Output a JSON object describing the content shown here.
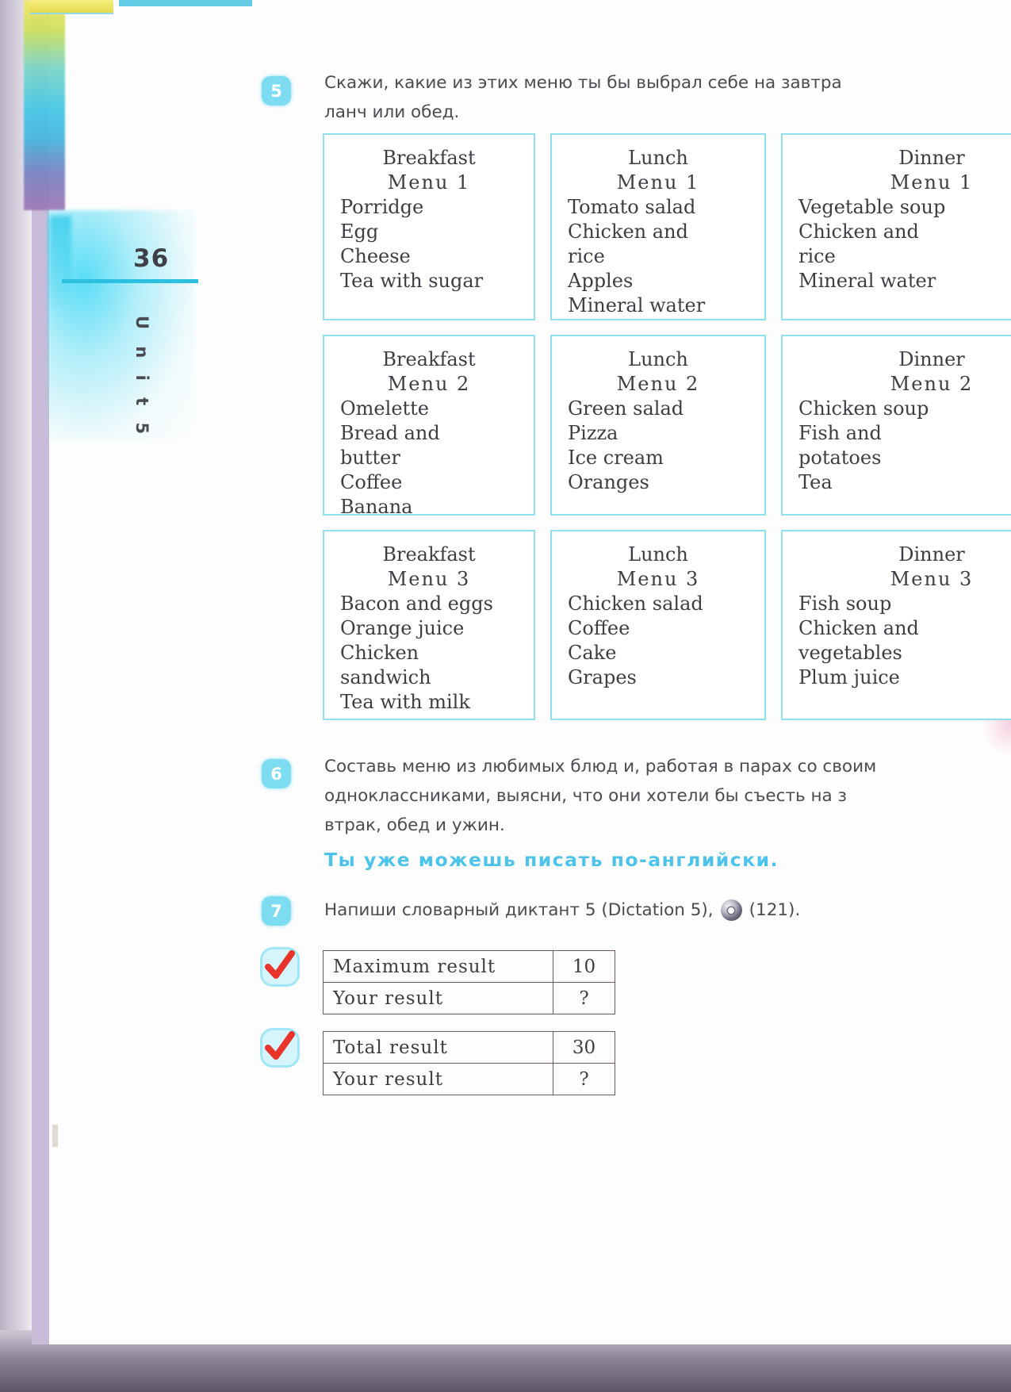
{
  "page": {
    "number": "36",
    "unit_label": "U n i t",
    "unit_number": "5"
  },
  "exercise5": {
    "badge": "5",
    "text": "Скажи, какие из этих меню ты бы выбрал себе на завтра\nланч или обед."
  },
  "menus": [
    {
      "title": "Breakfast",
      "subtitle": "Menu 1",
      "items": "Porridge\nEgg\nCheese\nTea with sugar"
    },
    {
      "title": "Lunch",
      "subtitle": "Menu 1",
      "items": "Tomato salad\nChicken and\nrice\nApples\nMineral water"
    },
    {
      "title": "Dinner",
      "subtitle": "Menu 1",
      "items": "Vegetable soup\nChicken and\nrice\nMineral water"
    },
    {
      "title": "Breakfast",
      "subtitle": "Menu 2",
      "items": "Omelette\nBread and\nbutter\nCoffee\nBanana"
    },
    {
      "title": "Lunch",
      "subtitle": "Menu 2",
      "items": "Green salad\nPizza\nIce cream\nOranges"
    },
    {
      "title": "Dinner",
      "subtitle": "Menu 2",
      "items": "Chicken soup\nFish and\npotatoes\nTea"
    },
    {
      "title": "Breakfast",
      "subtitle": "Menu 3",
      "items": "Bacon and eggs\nOrange juice\nChicken\nsandwich\nTea with milk"
    },
    {
      "title": "Lunch",
      "subtitle": "Menu 3",
      "items": "Chicken salad\nCoffee\nCake\nGrapes"
    },
    {
      "title": "Dinner",
      "subtitle": "Menu 3",
      "items": "Fish soup\nChicken and\nvegetables\nPlum juice"
    }
  ],
  "exercise6": {
    "badge": "6",
    "text": "Составь меню из любимых блюд и, работая в парах со своим\nодноклассниками, выясни, что они хотели бы съесть на з\nвтрак, обед и ужин."
  },
  "heading": {
    "text": "Ты уже можешь писать по-английски."
  },
  "exercise7": {
    "badge": "7",
    "text_before": "Напиши словарный диктант 5 (Dictation 5),",
    "icon": "cd-icon",
    "text_after": "(121)."
  },
  "result_tables": [
    {
      "rows": [
        {
          "label": "Maximum result",
          "value": "10"
        },
        {
          "label": "Your result",
          "value": "?"
        }
      ]
    },
    {
      "rows": [
        {
          "label": "Total result",
          "value": "30"
        },
        {
          "label": "Your result",
          "value": "?"
        }
      ]
    }
  ],
  "colors": {
    "accent_cyan": "#7ddcf2",
    "heading_blue": "#4cc3ea",
    "box_border": "#8fe0ef",
    "table_border": "#6b5a55",
    "check_red": "#e8342a"
  }
}
